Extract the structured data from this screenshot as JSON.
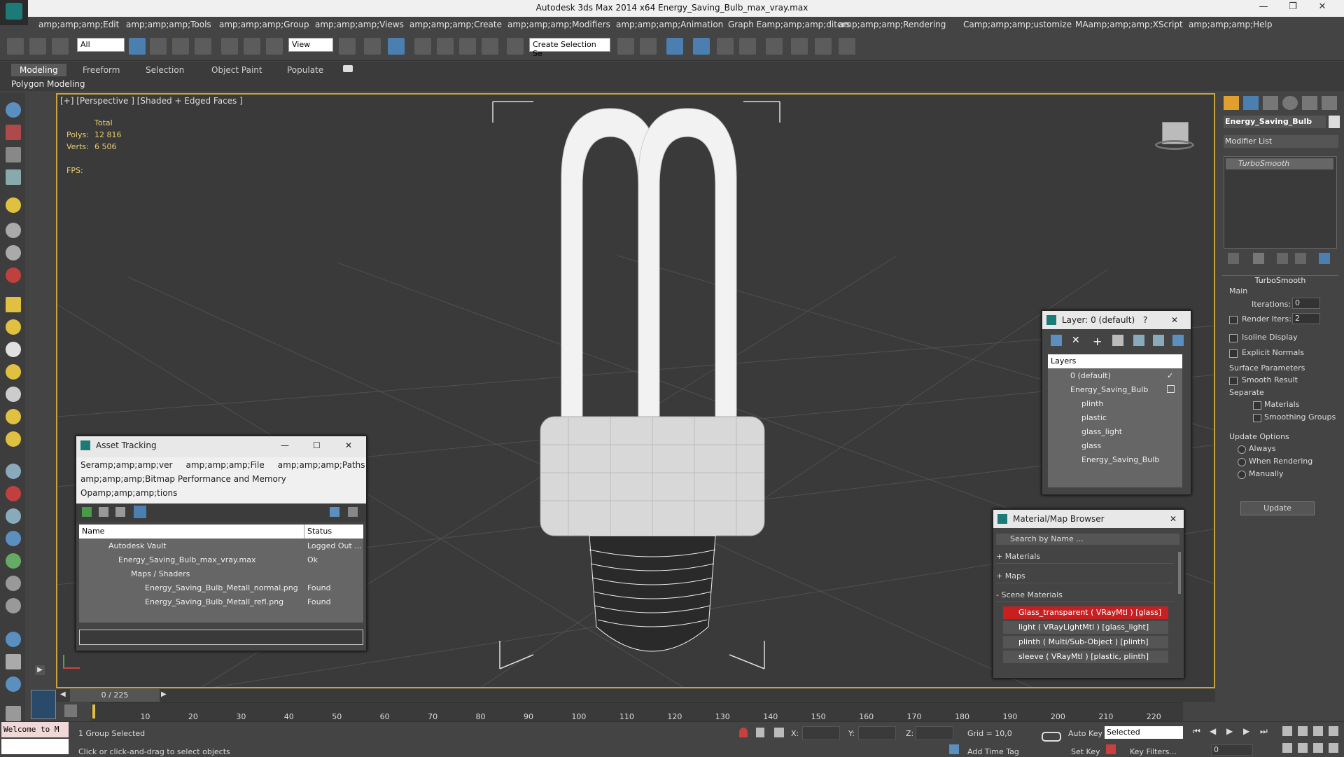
{
  "app": {
    "title": "Autodesk 3ds Max  2014 x64     Energy_Saving_Bulb_max_vray.max"
  },
  "menu": [
    "amp;amp;amp;Edit",
    "amp;amp;amp;Tools",
    "amp;amp;amp;Group",
    "amp;amp;amp;Views",
    "amp;amp;amp;Create",
    "amp;amp;amp;Modifiers",
    "amp;amp;amp;Animation",
    "Graph Eamp;amp;amp;ditors",
    "amp;amp;amp;Rendering",
    "Camp;amp;amp;ustomize",
    "MAamp;amp;amp;XScript",
    "amp;amp;amp;Help"
  ],
  "toolbar": {
    "filter_value": "All",
    "refcoord_value": "View",
    "selection_set_placeholder": "Create Selection Se"
  },
  "ribbon": {
    "tabs": [
      "Modeling",
      "Freeform",
      "Selection",
      "Object Paint",
      "Populate"
    ],
    "sub_label": "Polygon Modeling"
  },
  "viewport": {
    "label": "[+] [Perspective ] [Shaded + Edged Faces ]",
    "stats": {
      "total_label": "Total",
      "polys_label": "Polys:",
      "polys_value": "12 816",
      "verts_label": "Verts:",
      "verts_value": "6 506",
      "fps_label": "FPS:"
    }
  },
  "command_panel": {
    "object_name": "Energy_Saving_Bulb",
    "modifier_list": "Modifier List",
    "stack_item": "TurboSmooth",
    "rollout_title": "TurboSmooth",
    "main_label": "Main",
    "iterations_label": "Iterations:",
    "iterations_value": "0",
    "render_iters_label": "Render Iters:",
    "render_iters_value": "2",
    "isoline": "Isoline Display",
    "explicit_normals": "Explicit Normals",
    "surface_params": "Surface Parameters",
    "smooth_result": "Smooth Result",
    "separate": "Separate",
    "materials": "Materials",
    "smoothing_groups": "Smoothing Groups",
    "update_options": "Update Options",
    "always": "Always",
    "when_rendering": "When Rendering",
    "manually": "Manually",
    "update_button": "Update"
  },
  "layer_window": {
    "title": "Layer: 0 (default)",
    "help": "?",
    "header": "Layers",
    "items": [
      "0 (default)",
      "Energy_Saving_Bulb",
      "plinth",
      "plastic",
      "glass_light",
      "glass",
      "Energy_Saving_Bulb"
    ]
  },
  "material_browser": {
    "title": "Material/Map Browser",
    "search_placeholder": "Search by Name ...",
    "sections": [
      "+ Materials",
      "+ Maps",
      "- Scene Materials"
    ],
    "scene_materials": [
      "Glass_transparent ( VRayMtl ) [glass]",
      "light ( VRayLightMtl ) [glass_light]",
      "plinth ( Multi/Sub-Object ) [plinth]",
      "sleeve ( VRayMtl ) [plastic, plinth]"
    ]
  },
  "asset_tracking": {
    "title": "Asset Tracking",
    "menu_line1": "Seramp;amp;amp;ver     amp;amp;amp;File     amp;amp;amp;Paths",
    "menu_line2": "amp;amp;amp;Bitmap Performance and Memory",
    "menu_line3": "Opamp;amp;amp;tions",
    "col_name": "Name",
    "col_status": "Status",
    "rows": [
      {
        "name": "Autodesk Vault",
        "status": "Logged Out ..."
      },
      {
        "name": "Energy_Saving_Bulb_max_vray.max",
        "status": "Ok"
      },
      {
        "name": "Maps / Shaders",
        "status": ""
      },
      {
        "name": "Energy_Saving_Bulb_Metall_normal.png",
        "status": "Found"
      },
      {
        "name": "Energy_Saving_Bulb_Metall_refl.png",
        "status": "Found"
      }
    ]
  },
  "timeline": {
    "frame_label": "0 / 225",
    "ticks": [
      "10",
      "20",
      "30",
      "40",
      "50",
      "60",
      "70",
      "80",
      "90",
      "100",
      "110",
      "120",
      "130",
      "140",
      "150",
      "160",
      "170",
      "180",
      "190",
      "200",
      "210",
      "220"
    ]
  },
  "status": {
    "maxscript": "Welcome to M",
    "selection": "1 Group Selected",
    "prompt": "Click or click-and-drag to select objects",
    "x_label": "X:",
    "y_label": "Y:",
    "z_label": "Z:",
    "grid": "Grid = 10,0",
    "add_time_tag": "Add Time Tag",
    "auto_key": "Auto Key",
    "selected": "Selected",
    "set_key": "Set Key",
    "key_filters": "Key Filters...",
    "frame_value": "0"
  }
}
